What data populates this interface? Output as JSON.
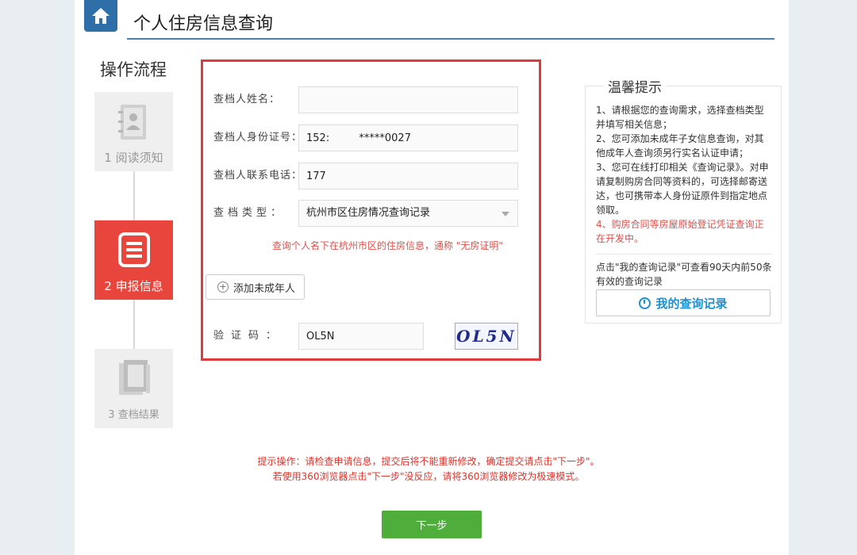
{
  "header": {
    "title": "个人住房信息查询"
  },
  "steps": {
    "title": "操作流程",
    "items": [
      {
        "label": "1 阅读须知"
      },
      {
        "label": "2 申报信息"
      },
      {
        "label": "3 查档结果"
      }
    ]
  },
  "form": {
    "name_label": "查档人姓名：",
    "name_value": "",
    "id_label": "查档人身份证号：",
    "id_value": "152:         *****0027",
    "phone_label": "查档人联系电话：",
    "phone_value": "177",
    "type_label": "查档类型：",
    "type_value": "杭州市区住房情况查询记录",
    "type_note": "查询个人名下在杭州市区的住房信息，通称 \"无房证明\"",
    "add_minor_label": "添加未成年人",
    "captcha_label": "验证码：",
    "captcha_value": "OL5N",
    "captcha_image_text": "OL5N"
  },
  "tips": {
    "title": "温馨提示",
    "items": [
      "1、请根据您的查询需求，选择查档类型并填写相关信息；",
      "2、您可添加未成年子女信息查询，对其他成年人查询须另行实名认证申请；",
      "3、您可在线打印相关《查询记录》。对申请复制购房合同等资料的，可选择邮寄送达，也可携带本人身份证原件到指定地点领取。",
      "4、购房合同等房屋原始登记凭证查询正在开发中。"
    ],
    "record_note": "点击\"我的查询记录\"可查看90天内前50条有效的查询记录",
    "record_button": "我的查询记录"
  },
  "hints": {
    "line1": "提示操作：请检查申请信息，提交后将不能重新修改，确定提交请点击\"下一步\"。",
    "line2": "若使用360浏览器点击\"下一步\"没反应，请将360浏览器修改为极速模式。"
  },
  "next_button": "下一步",
  "colors": {
    "accent_red": "#e8453c",
    "form_border": "#e0393e",
    "header_blue": "#2f6fa8",
    "next_green": "#4fae3b",
    "link_blue": "#1f8fd0"
  },
  "icons": [
    "home-icon",
    "contact-book-icon",
    "document-list-icon",
    "book-icon",
    "plus-circle-icon",
    "clock-icon",
    "dropdown-arrow-icon"
  ]
}
